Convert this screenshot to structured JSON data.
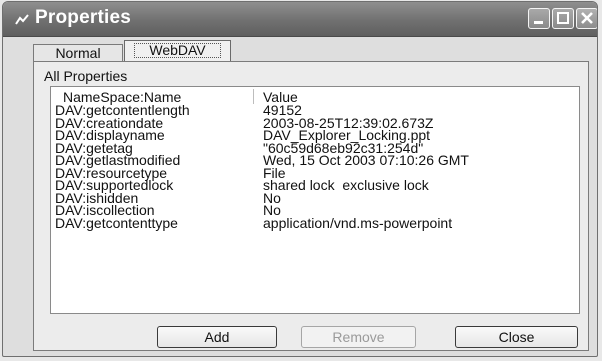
{
  "window": {
    "title": "Properties"
  },
  "tabs": [
    {
      "label": "Normal",
      "selected": false
    },
    {
      "label": "WebDAV",
      "selected": true
    }
  ],
  "group_label": "All Properties",
  "columns": {
    "name": "NameSpace:Name",
    "value": "Value"
  },
  "properties": [
    {
      "name": "DAV:getcontentlength",
      "value": "49152"
    },
    {
      "name": "DAV:creationdate",
      "value": "2003-08-25T12:39:02.673Z"
    },
    {
      "name": "DAV:displayname",
      "value": "DAV_Explorer_Locking.ppt"
    },
    {
      "name": "DAV:getetag",
      "value": "\"60c59d68eb92c31:254d\""
    },
    {
      "name": "DAV:getlastmodified",
      "value": "Wed, 15 Oct 2003 07:10:26 GMT"
    },
    {
      "name": "DAV:resourcetype",
      "value": "File"
    },
    {
      "name": "DAV:supportedlock",
      "value": "shared lock  exclusive lock"
    },
    {
      "name": "DAV:ishidden",
      "value": "No"
    },
    {
      "name": "DAV:iscollection",
      "value": "No"
    },
    {
      "name": "DAV:getcontenttype",
      "value": "application/vnd.ms-powerpoint"
    }
  ],
  "buttons": {
    "add": "Add",
    "remove": "Remove",
    "close": "Close"
  },
  "icons": {
    "title": "properties-window-icon",
    "minimize": "minimize-icon",
    "maximize": "maximize-icon",
    "close": "close-icon"
  }
}
